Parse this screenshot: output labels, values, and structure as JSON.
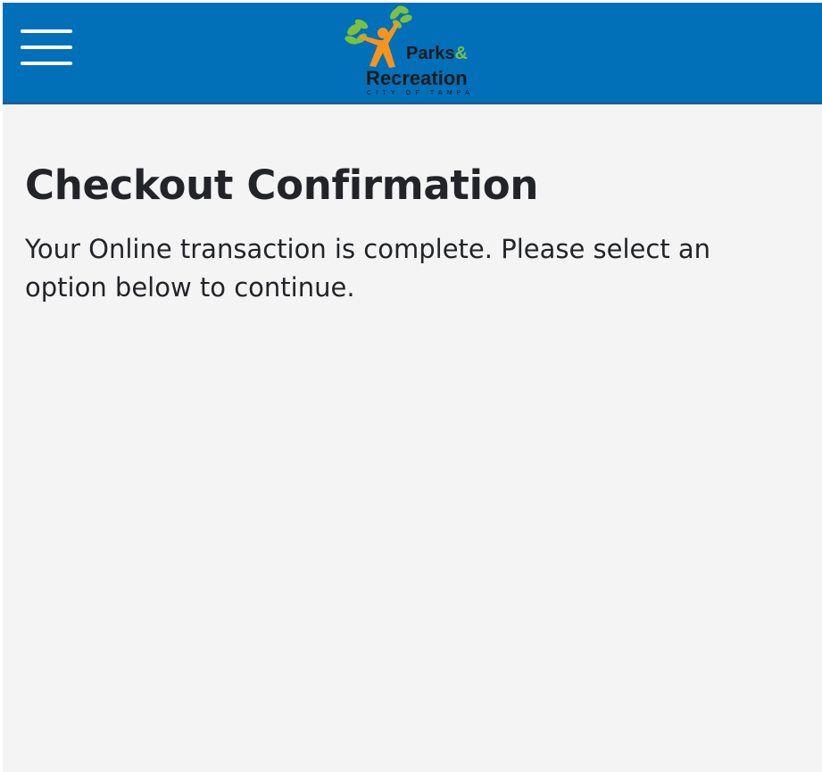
{
  "header": {
    "menu_icon": "hamburger-menu-icon",
    "background_color": "#0170b9",
    "logo": {
      "line1_text": "Parks",
      "line1_amp": "&",
      "line2_text": "Recreation",
      "line3_text": "CITY OF TAMPA",
      "colors": {
        "figure": "#f7941d",
        "leaves": "#7ac142",
        "text": "#1b1b1b"
      }
    }
  },
  "main": {
    "title": "Checkout Confirmation",
    "message": "Your Online transaction is complete. Please select an option below to continue."
  }
}
